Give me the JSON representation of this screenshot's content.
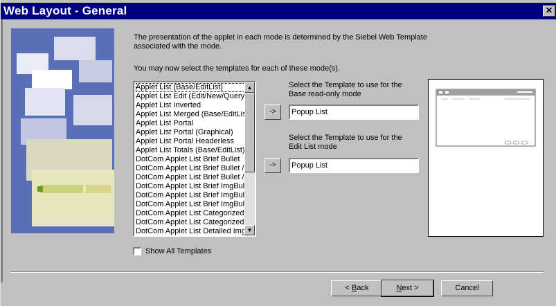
{
  "window": {
    "title": "Web Layout - General"
  },
  "intro": {
    "line1": "The presentation of the applet in each mode is determined by the Siebel Web Template",
    "line2": "associated with the mode.",
    "line3": "You may now select the templates for each of these mode(s)."
  },
  "templates_list": {
    "items": [
      "Applet List (Base/EditList)",
      "Applet List Edit (Edit/New/Query)",
      "Applet List Inverted",
      "Applet List Merged (Base/EditList)",
      "Applet List Portal",
      "Applet List Portal (Graphical)",
      "Applet List Portal Headerless",
      "Applet List Totals (Base/EditList)",
      "DotCom Applet List Brief Bullet",
      "DotCom Applet List Brief Bullet / Bl",
      "DotCom Applet List Brief Bullet / Sp",
      "DotCom Applet List Brief ImgBullet",
      "DotCom Applet List Brief ImgBullet",
      "DotCom Applet List Brief ImgBullet",
      "DotCom Applet List Categorized Bu",
      "DotCom Applet List Categorized Bu",
      "DotCom Applet List Detailed ImgBu",
      "DotCom Applet List Detailed ImgBu"
    ],
    "selected_index": 0
  },
  "mode_base": {
    "label_line1": "Select the Template to use for the",
    "label_line2": "Base read-only mode",
    "arrow": "->",
    "value": "Popup List"
  },
  "mode_edit": {
    "label_line1": "Select the Template to use for the",
    "label_line2": "Edit List mode",
    "arrow": "->",
    "value": "Popup List"
  },
  "show_all": {
    "label": "Show All Templates",
    "checked": false
  },
  "buttons": {
    "back_prefix": "< ",
    "back_key": "B",
    "back_rest": "ack",
    "next_key": "N",
    "next_rest": "ext >",
    "cancel": "Cancel"
  }
}
